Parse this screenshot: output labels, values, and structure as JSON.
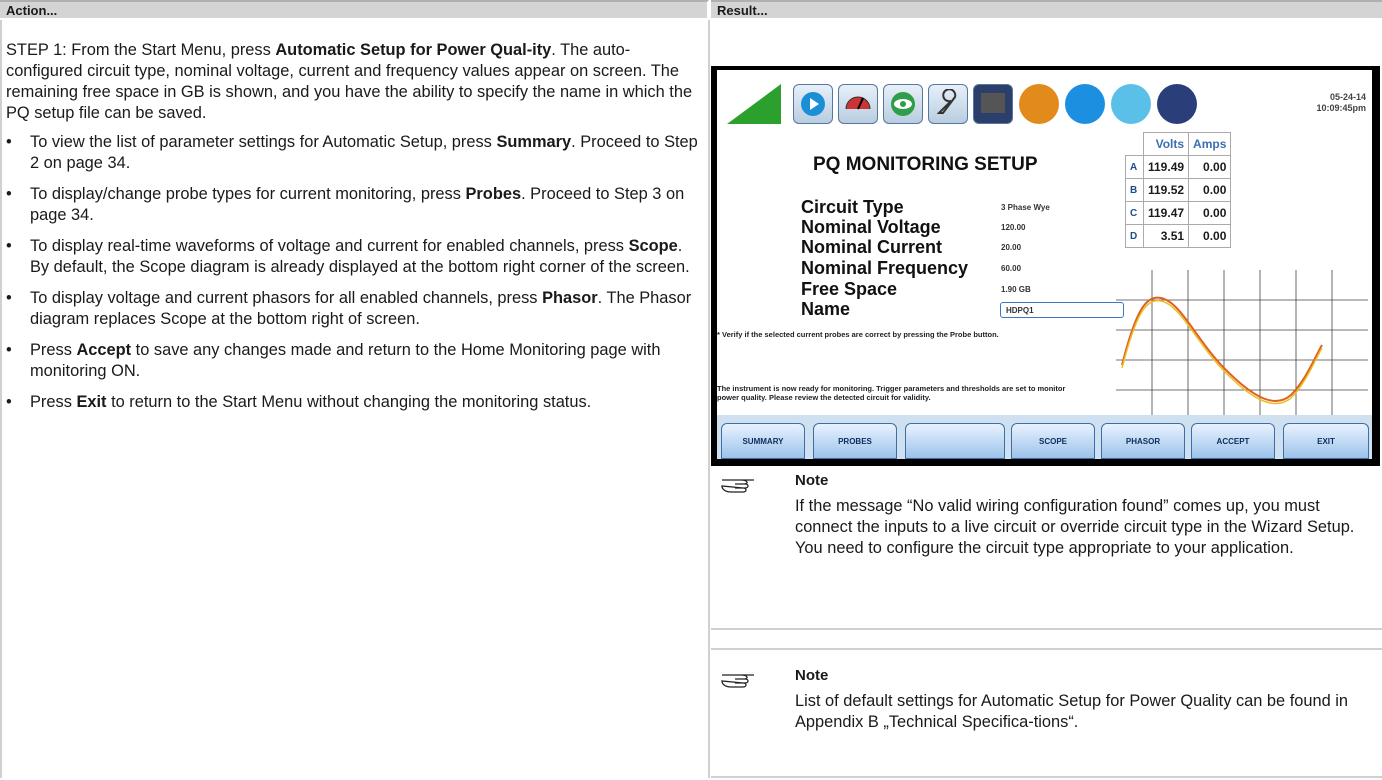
{
  "header": {
    "left": "Action...",
    "right": "Result..."
  },
  "step": {
    "prefix": "STEP 1: From the Start Menu, press ",
    "bold": "Automatic Setup for Power Qual-ity",
    "suffix": ". The auto- configured circuit type, nominal voltage, current and frequency values appear on screen. The remaining free space in GB is shown, and you have the ability to specify the name in which the PQ setup file can be saved."
  },
  "bullets": [
    {
      "pre": "To view the list of parameter settings for Automatic Setup, press ",
      "bold": "Summary",
      "post": ". Proceed to Step 2 on page 34."
    },
    {
      "pre": "To display/change probe types for current monitoring, press ",
      "bold": "Probes",
      "post": ". Proceed to Step 3 on page 34."
    },
    {
      "pre": "To display real-time waveforms of voltage and current for enabled channels, press ",
      "bold": "Scope",
      "post": ". By default, the Scope diagram is already displayed at the bottom right corner of the screen."
    },
    {
      "pre": "To display voltage and current phasors for all enabled channels, press ",
      "bold": "Phasor",
      "post": ". The Phasor diagram replaces Scope at the bottom right of screen."
    },
    {
      "pre": "Press ",
      "bold": "Accept",
      "post": " to save any changes made and return to the Home Monitoring page with monitoring ON."
    },
    {
      "pre": "Press ",
      "bold": "Exit",
      "post": " to return to the Start Menu without changing the monitoring status."
    }
  ],
  "device": {
    "date": "05-24-14",
    "time": "10:09:45pm",
    "title": "PQ MONITORING SETUP",
    "params": [
      {
        "label": "Circuit Type",
        "value": "3 Phase Wye"
      },
      {
        "label": "Nominal Voltage",
        "value": "120.00"
      },
      {
        "label": "Nominal Current",
        "value": "20.00"
      },
      {
        "label": "Nominal Frequency",
        "value": "60.00"
      },
      {
        "label": "Free Space",
        "value": "1.90 GB"
      },
      {
        "label": "Name",
        "value": "HDPQ1"
      }
    ],
    "table": {
      "headers": [
        "Volts",
        "Amps"
      ],
      "rows": [
        {
          "ch": "A",
          "volts": "119.49",
          "amps": "0.00"
        },
        {
          "ch": "B",
          "volts": "119.52",
          "amps": "0.00"
        },
        {
          "ch": "C",
          "volts": "119.47",
          "amps": "0.00"
        },
        {
          "ch": "D",
          "volts": "3.51",
          "amps": "0.00"
        }
      ]
    },
    "msg1": "* Verify if the selected current probes are correct by pressing the Probe button.",
    "msg2a": "The instrument is now ready for monitoring. Trigger parameters and thresholds are set to monitor",
    "msg2b": "power quality. Please review the detected circuit for validity.",
    "softkeys": [
      "SUMMARY",
      "PROBES",
      "",
      "SCOPE",
      "PHASOR",
      "ACCEPT",
      "EXIT"
    ],
    "colors": {
      "screen_bg": "#ffffff",
      "accent": "#3a79c0",
      "trace1": "#e06020",
      "trace2": "#e8c020"
    }
  },
  "notes": [
    {
      "head": "Note",
      "text": "If the message “No valid wiring configuration found” comes up, you must connect the inputs to a live circuit or override circuit type in the Wizard Setup. You need to configure the circuit type appropriate to your application."
    },
    {
      "head": "Note",
      "text": "List of default settings for Automatic Setup for Power Quality can be found in Appendix B „Technical Specifica-tions“."
    }
  ]
}
